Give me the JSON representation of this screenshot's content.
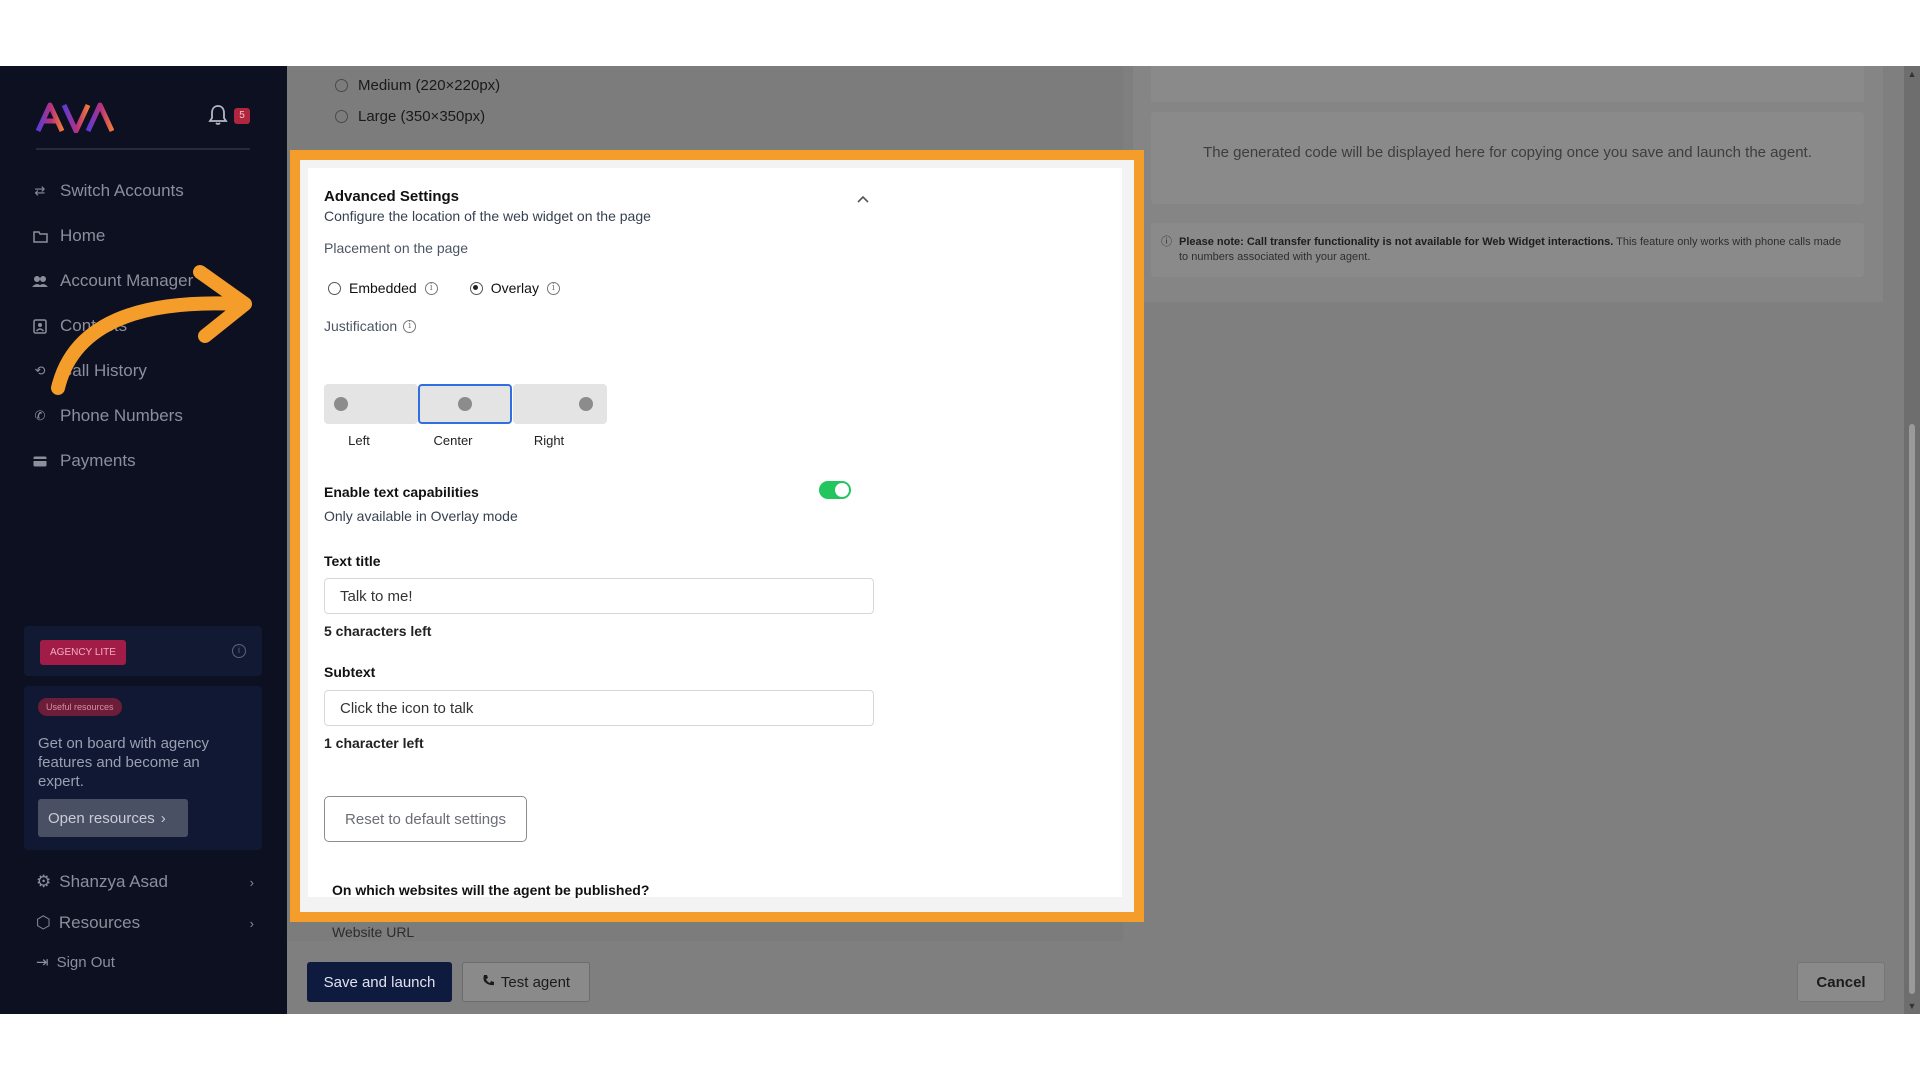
{
  "sidebar": {
    "logo": "AVA",
    "notifications_count": "5",
    "nav": [
      {
        "label": "Switch Accounts",
        "icon": "switch-icon"
      },
      {
        "label": "Home",
        "icon": "folder-icon"
      },
      {
        "label": "Account Manager",
        "icon": "users-icon"
      },
      {
        "label": "Contacts",
        "icon": "contacts-icon"
      },
      {
        "label": "Call History",
        "icon": "history-icon"
      },
      {
        "label": "Phone Numbers",
        "icon": "phone-icon"
      },
      {
        "label": "Payments",
        "icon": "card-icon"
      }
    ],
    "plan_badge": "AGENCY LITE",
    "resources_badge": "Useful resources",
    "resources_text": "Get on board with agency features and become an expert.",
    "resources_button": "Open resources",
    "user_name": "Shanzya Asad",
    "resources_link": "Resources",
    "sign_out": "Sign Out"
  },
  "sizes": {
    "medium": "Medium (220×220px)",
    "large": "Large (350×350px)"
  },
  "advanced": {
    "title": "Advanced Settings",
    "subtitle": "Configure the location of the web widget on the page",
    "placement_label": "Placement on the page",
    "placement_options": [
      "Embedded",
      "Overlay"
    ],
    "placement_selected": "Overlay",
    "justification_label": "Justification",
    "justification_options": [
      "Left",
      "Center",
      "Right"
    ],
    "justification_selected": "Center",
    "text_capabilities_label": "Enable text capabilities",
    "text_capabilities_hint": "Only available in Overlay mode",
    "text_capabilities_enabled": true,
    "text_title_label": "Text title",
    "text_title_value": "Talk to me!",
    "text_title_counter": "5 characters left",
    "subtext_label": "Subtext",
    "subtext_value": "Click the icon to talk",
    "subtext_counter": "1 character left",
    "reset_button": "Reset to default settings"
  },
  "right": {
    "code_placeholder": "The generated code will be displayed here for copying once you save and launch the agent.",
    "note_bold": "Please note: Call transfer functionality is not available for Web Widget interactions.",
    "note_rest": " This feature only works with phone calls made to numbers associated with your agent."
  },
  "websites": {
    "question": "On which websites will the agent be published?",
    "url_label": "Website URL"
  },
  "footer": {
    "save": "Save and launch",
    "test": "Test agent",
    "cancel": "Cancel"
  },
  "colors": {
    "highlight": "#f59d2a",
    "toggle_on": "#22c55e",
    "selected_border": "#2f6fe0",
    "sidebar_bg": "#0c1020"
  }
}
